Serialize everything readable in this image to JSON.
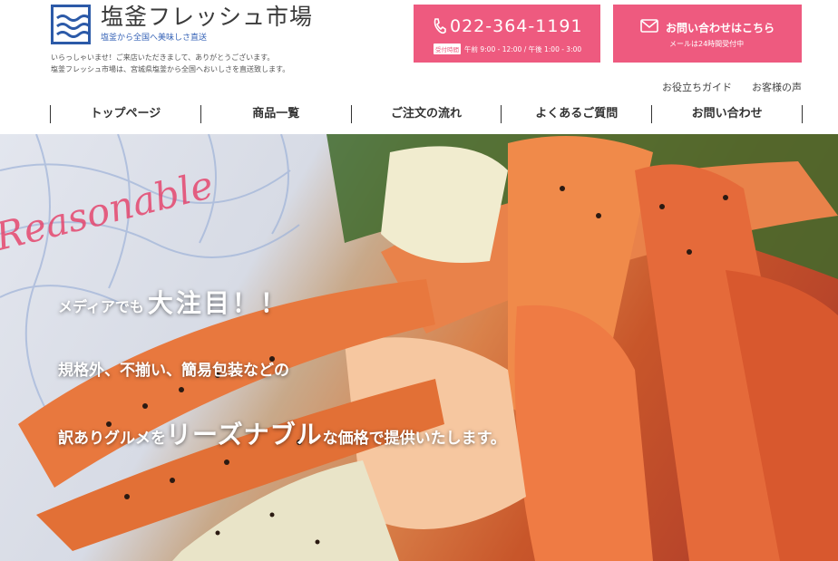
{
  "header": {
    "site_title": "塩釜フレッシュ市場",
    "tagline": "塩釜から全国へ美味しさ直送",
    "intro_line1": "いらっしゃいませ！ご来店いただきまして、ありがとうございます。",
    "intro_line2": "塩釜フレッシュ市場は、宮城県塩釜から全国へおいしさを直送致します。"
  },
  "phone_cta": {
    "number": "022-364-1191",
    "badge": "受付時間",
    "hours": "午前 9:00 - 12:00 / 午後 1:00 - 3:00"
  },
  "mail_cta": {
    "label": "お問い合わせはこちら",
    "sub": "メールは24時間受付中"
  },
  "sublinks": {
    "guide": "お役立ちガイド",
    "voice": "お客様の声"
  },
  "nav": {
    "items": [
      "トップページ",
      "商品一覧",
      "ご注文の流れ",
      "よくあるご質問",
      "お問い合わせ"
    ]
  },
  "hero": {
    "script_text": "Reasonable",
    "line1_small": "メディアでも",
    "line1_big": "大注目！！",
    "line2": "規格外、不揃い、簡易包装などの",
    "line3_pre": "訳ありグルメを",
    "line3_big": "リーズナブル",
    "line3_post": "な価格で提供いたします。"
  },
  "colors": {
    "accent": "#ee5a7f",
    "logo_blue": "#2c5aa8"
  }
}
